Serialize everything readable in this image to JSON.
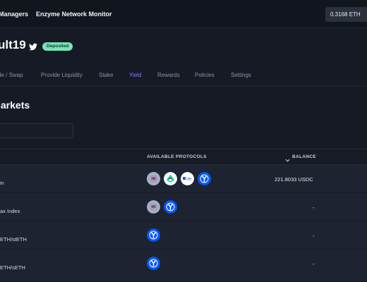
{
  "topbar": {
    "nav": [
      "Managers",
      "Enzyme Network Monitor"
    ],
    "eth_balance": "0.3168 ETH"
  },
  "vault": {
    "title": "ult19",
    "badge": "Deposited"
  },
  "tabs": [
    {
      "label": "de / Swap",
      "active": false
    },
    {
      "label": "Provide Liquidity",
      "active": false
    },
    {
      "label": "Stake",
      "active": false
    },
    {
      "label": "Yield",
      "active": true
    },
    {
      "label": "Rewards",
      "active": false
    },
    {
      "label": "Policies",
      "active": false
    },
    {
      "label": "Settings",
      "active": false
    }
  ],
  "section": {
    "title": "larkets"
  },
  "table": {
    "headers": {
      "protocols": "AVAILABLE PROTOCOLS",
      "balance": "BALANCE"
    },
    "rows": [
      {
        "name": "in",
        "protocols": [
          "aave-icon",
          "compound-icon",
          "idle-icon",
          "yearn-icon"
        ],
        "balance": "221.8033 USDC"
      },
      {
        "name": "ax Index",
        "protocols": [
          "aave-icon",
          "yearn-icon"
        ],
        "balance": "-"
      },
      {
        "name": "ETH/stETH",
        "protocols": [
          "yearn-icon"
        ],
        "balance": "-"
      },
      {
        "name": "ETH/sETH",
        "protocols": [
          "yearn-icon"
        ],
        "balance": "-"
      }
    ]
  },
  "colors": {
    "background": "#151a24",
    "accent": "#8b7cff",
    "badge": "#79e3b8",
    "yearn": "#0657f9"
  }
}
